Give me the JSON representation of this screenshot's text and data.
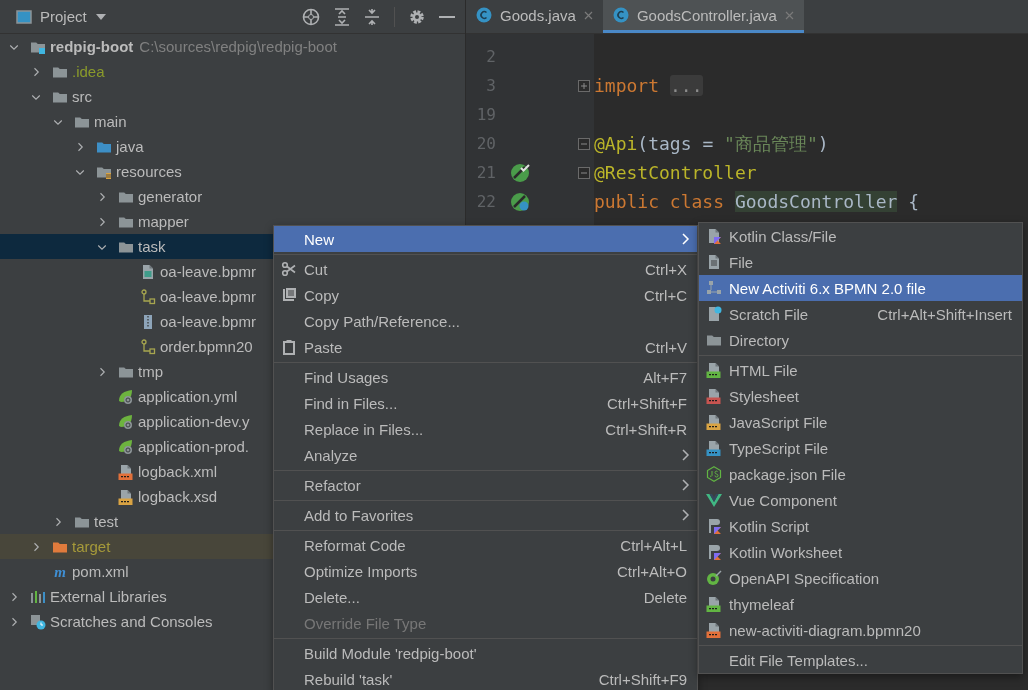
{
  "project_panel": {
    "title": "Project",
    "tree": [
      {
        "label": "redpig-boot",
        "path": "C:\\sources\\redpig\\redpig-boot",
        "kind": "module",
        "expanded": true,
        "selected": false,
        "children": [
          {
            "label": ".idea",
            "kind": "ignored-folder",
            "expanded": false,
            "selected": false
          },
          {
            "label": "src",
            "kind": "folder",
            "expanded": true,
            "selected": false,
            "children": [
              {
                "label": "main",
                "kind": "folder",
                "expanded": true,
                "selected": false,
                "children": [
                  {
                    "label": "java",
                    "kind": "source-folder",
                    "expanded": false,
                    "selected": false
                  },
                  {
                    "label": "resources",
                    "kind": "resource-folder",
                    "expanded": true,
                    "selected": false,
                    "children": [
                      {
                        "label": "generator",
                        "kind": "folder",
                        "expanded": false,
                        "selected": false
                      },
                      {
                        "label": "mapper",
                        "kind": "folder",
                        "expanded": false,
                        "selected": false
                      },
                      {
                        "label": "task",
                        "kind": "folder",
                        "expanded": true,
                        "selected": true,
                        "children": [
                          {
                            "label": "oa-leave.bpmr",
                            "kind": "image-file",
                            "selected": false
                          },
                          {
                            "label": "oa-leave.bpmr",
                            "kind": "diagram-file",
                            "selected": false
                          },
                          {
                            "label": "oa-leave.bpmr",
                            "kind": "archive-file",
                            "selected": false
                          },
                          {
                            "label": "order.bpmn20",
                            "kind": "diagram-file",
                            "selected": false
                          }
                        ]
                      },
                      {
                        "label": "tmp",
                        "kind": "folder",
                        "expanded": false,
                        "selected": false
                      },
                      {
                        "label": "application.yml",
                        "kind": "spring-file",
                        "selected": false
                      },
                      {
                        "label": "application-dev.y",
                        "kind": "spring-file",
                        "selected": false
                      },
                      {
                        "label": "application-prod.",
                        "kind": "spring-file",
                        "selected": false
                      },
                      {
                        "label": "logback.xml",
                        "kind": "xml-file",
                        "selected": false
                      },
                      {
                        "label": "logback.xsd",
                        "kind": "xsd-file",
                        "selected": false
                      }
                    ]
                  }
                ]
              },
              {
                "label": "test",
                "kind": "folder",
                "expanded": false,
                "selected": false
              }
            ]
          },
          {
            "label": "target",
            "kind": "excluded-folder",
            "expanded": false,
            "selected": false
          },
          {
            "label": "pom.xml",
            "kind": "maven",
            "badge": "m",
            "selected": false
          }
        ]
      },
      {
        "label": "External Libraries",
        "kind": "libraries",
        "expanded": false,
        "selected": false
      },
      {
        "label": "Scratches and Consoles",
        "kind": "scratches",
        "expanded": false,
        "selected": false
      }
    ]
  },
  "editor": {
    "tabs": [
      {
        "label": "Goods.java",
        "selected": false
      },
      {
        "label": "GoodsController.java",
        "selected": true
      }
    ],
    "lines": [
      {
        "number": "2"
      },
      {
        "number": "3",
        "folded": true,
        "tokens": [
          {
            "text": "import",
            "kind": "keyword"
          },
          {
            "text": "...",
            "kind": "folded"
          }
        ]
      },
      {
        "number": "19"
      },
      {
        "number": "20",
        "folded": false,
        "tokens": [
          {
            "text": "@Api",
            "kind": "annotation"
          },
          {
            "text": "(tags = ",
            "kind": "plain"
          },
          {
            "text": "\"商品管理\"",
            "kind": "string"
          },
          {
            "text": ")",
            "kind": "plain"
          }
        ]
      },
      {
        "number": "21",
        "gutter": {
          "kind": "bean-check"
        },
        "folded": false,
        "tokens": [
          {
            "text": "@RestController",
            "kind": "annotation"
          }
        ]
      },
      {
        "number": "22",
        "gutter": {
          "kind": "bean"
        },
        "tokens": [
          {
            "text": "public class ",
            "kind": "keyword"
          },
          {
            "text": "GoodsController",
            "kind": "highlighted"
          },
          {
            "text": " {",
            "kind": "plain"
          }
        ]
      }
    ]
  },
  "context_menu": {
    "groups": [
      {
        "items": [
          {
            "label": "New",
            "submenu": true,
            "selected": true,
            "disabled": false
          }
        ]
      },
      {
        "items": [
          {
            "label": "Cut",
            "kind": "scissors",
            "shortcut": "Ctrl+X",
            "submenu": false,
            "selected": false,
            "disabled": false
          },
          {
            "label": "Copy",
            "kind": "copy",
            "shortcut": "Ctrl+C",
            "submenu": false,
            "selected": false,
            "disabled": false
          },
          {
            "label": "Copy Path/Reference...",
            "submenu": false,
            "selected": false,
            "disabled": false
          },
          {
            "label": "Paste",
            "kind": "paste",
            "shortcut": "Ctrl+V",
            "submenu": false,
            "selected": false,
            "disabled": false
          }
        ]
      },
      {
        "items": [
          {
            "label": "Find Usages",
            "shortcut": "Alt+F7",
            "submenu": false,
            "selected": false,
            "disabled": false
          },
          {
            "label": "Find in Files...",
            "shortcut": "Ctrl+Shift+F",
            "submenu": false,
            "selected": false,
            "disabled": false
          },
          {
            "label": "Replace in Files...",
            "shortcut": "Ctrl+Shift+R",
            "submenu": false,
            "selected": false,
            "disabled": false
          },
          {
            "label": "Analyze",
            "submenu": true,
            "selected": false,
            "disabled": false
          }
        ]
      },
      {
        "items": [
          {
            "label": "Refactor",
            "submenu": true,
            "selected": false,
            "disabled": false
          }
        ]
      },
      {
        "items": [
          {
            "label": "Add to Favorites",
            "submenu": true,
            "selected": false,
            "disabled": false
          }
        ]
      },
      {
        "items": [
          {
            "label": "Reformat Code",
            "shortcut": "Ctrl+Alt+L",
            "submenu": false,
            "selected": false,
            "disabled": false
          },
          {
            "label": "Optimize Imports",
            "shortcut": "Ctrl+Alt+O",
            "submenu": false,
            "selected": false,
            "disabled": false
          },
          {
            "label": "Delete...",
            "shortcut": "Delete",
            "submenu": false,
            "selected": false,
            "disabled": false
          },
          {
            "label": "Override File Type",
            "submenu": false,
            "selected": false,
            "disabled": true
          }
        ]
      },
      {
        "items": [
          {
            "label": "Build Module 'redpig-boot'",
            "submenu": false,
            "selected": false,
            "disabled": false
          },
          {
            "label": "Rebuild 'task'",
            "shortcut": "Ctrl+Shift+F9",
            "submenu": false,
            "selected": false,
            "disabled": false
          }
        ]
      }
    ]
  },
  "submenu": {
    "groups": [
      {
        "items": [
          {
            "label": "Kotlin Class/File",
            "kind": "kotlin-file",
            "selected": false
          },
          {
            "label": "File",
            "kind": "file",
            "selected": false
          },
          {
            "label": "New Activiti 6.x BPMN 2.0 file",
            "kind": "activiti",
            "selected": true
          },
          {
            "label": "Scratch File",
            "kind": "scratch",
            "shortcut": "Ctrl+Alt+Shift+Insert",
            "selected": false
          },
          {
            "label": "Directory",
            "kind": "directory",
            "selected": false
          }
        ]
      },
      {
        "items": [
          {
            "label": "HTML File",
            "kind": "html",
            "selected": false
          },
          {
            "label": "Stylesheet",
            "kind": "css",
            "selected": false
          },
          {
            "label": "JavaScript File",
            "kind": "js",
            "selected": false
          },
          {
            "label": "TypeScript File",
            "kind": "ts",
            "selected": false
          },
          {
            "label": "package.json File",
            "kind": "package-json",
            "selected": false
          },
          {
            "label": "Vue Component",
            "kind": "vue",
            "selected": false
          },
          {
            "label": "Kotlin Script",
            "kind": "kotlin-script",
            "selected": false
          },
          {
            "label": "Kotlin Worksheet",
            "kind": "kotlin-script",
            "selected": false
          },
          {
            "label": "OpenAPI Specification",
            "kind": "openapi",
            "selected": false
          },
          {
            "label": "thymeleaf",
            "kind": "thymeleaf",
            "selected": false
          },
          {
            "label": "new-activiti-diagram.bpmn20",
            "kind": "xml-template",
            "selected": false
          }
        ]
      },
      {
        "items": [
          {
            "label": "Edit File Templates...",
            "selected": false
          }
        ]
      }
    ]
  }
}
